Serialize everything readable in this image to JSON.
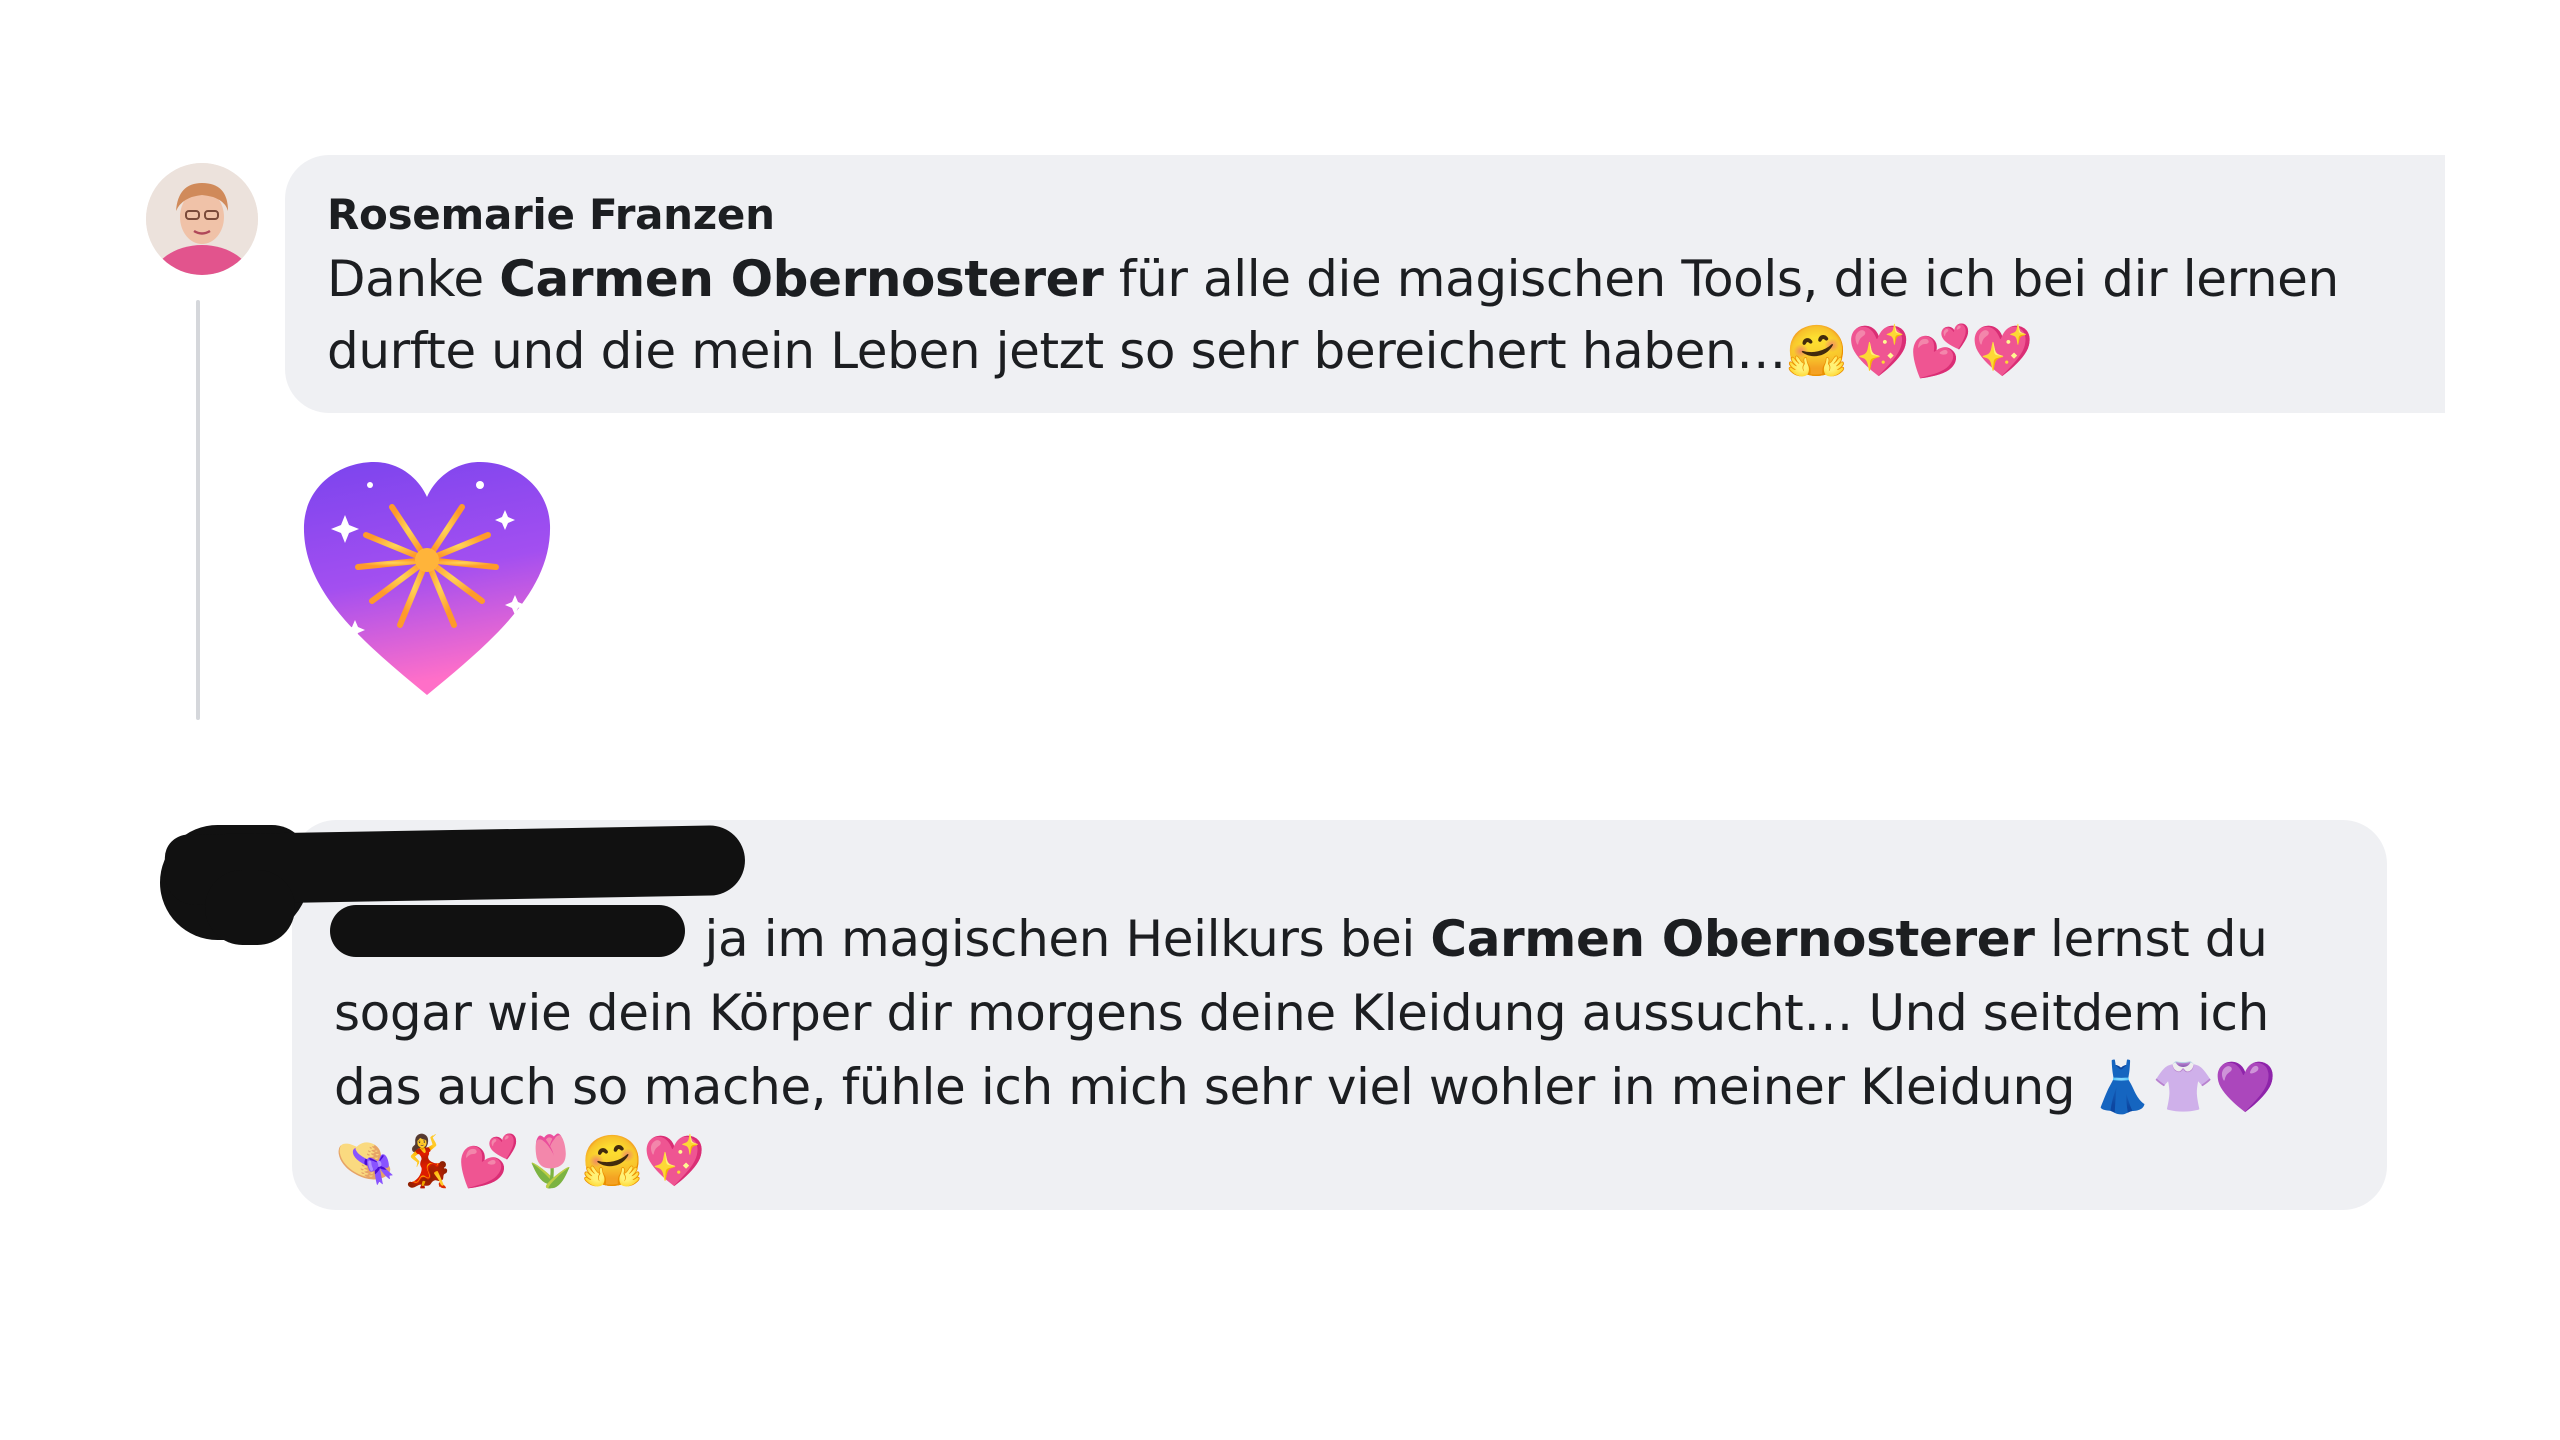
{
  "comments": [
    {
      "author": "Rosemarie Franzen",
      "text_before": "Danke ",
      "mention": "Carmen Obernosterer",
      "text_after": " für alle die magischen Tools, die ich bei dir lernen durfte und die mein Leben jetzt so sehr bereichert haben…",
      "emojis": "🤗💖💕💖",
      "sticker": "firework-heart-icon"
    },
    {
      "author_redacted": true,
      "text_before": " ja im magischen Heilkurs bei ",
      "mention": "Carmen Obernosterer",
      "text_after": " lernst du sogar wie dein Körper dir morgens deine Kleidung aussucht… Und seitdem ich das auch so mache, fühle ich mich sehr viel wohler in meiner Kleidung ",
      "emojis": "👗👚💜👒💃💕🌷🤗💖"
    }
  ],
  "colors": {
    "bubble": "#eff0f3",
    "text": "#1c1e21",
    "thread_line": "#d5d7db",
    "redaction": "#111111"
  }
}
